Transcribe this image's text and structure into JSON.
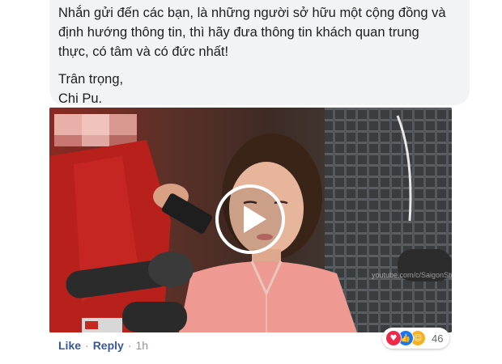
{
  "comment": {
    "lines": [
      "Nhắn gửi đến các bạn, là những người sở hữu một cộng đồng và",
      "định hướng thông tin, thì hãy đưa thông tin khách quan trung",
      "thực, có tâm và có đức nhất!"
    ],
    "signoff": "Trân trọng,",
    "signature": "Chi Pu."
  },
  "video": {
    "watermark": "youtube.com/c/SaigonStories18",
    "play_icon": "play-icon"
  },
  "actions": {
    "like": "Like",
    "reply": "Reply",
    "separator": "·",
    "time": "1h"
  },
  "reactions": {
    "icons": [
      "love-reaction-icon",
      "like-reaction-icon",
      "wow-reaction-icon"
    ],
    "count": "46"
  },
  "colors": {
    "link": "#385898",
    "bubble": "#f2f3f5",
    "love": "#f0284a",
    "like": "#1877f2",
    "wow": "#f7b125"
  }
}
